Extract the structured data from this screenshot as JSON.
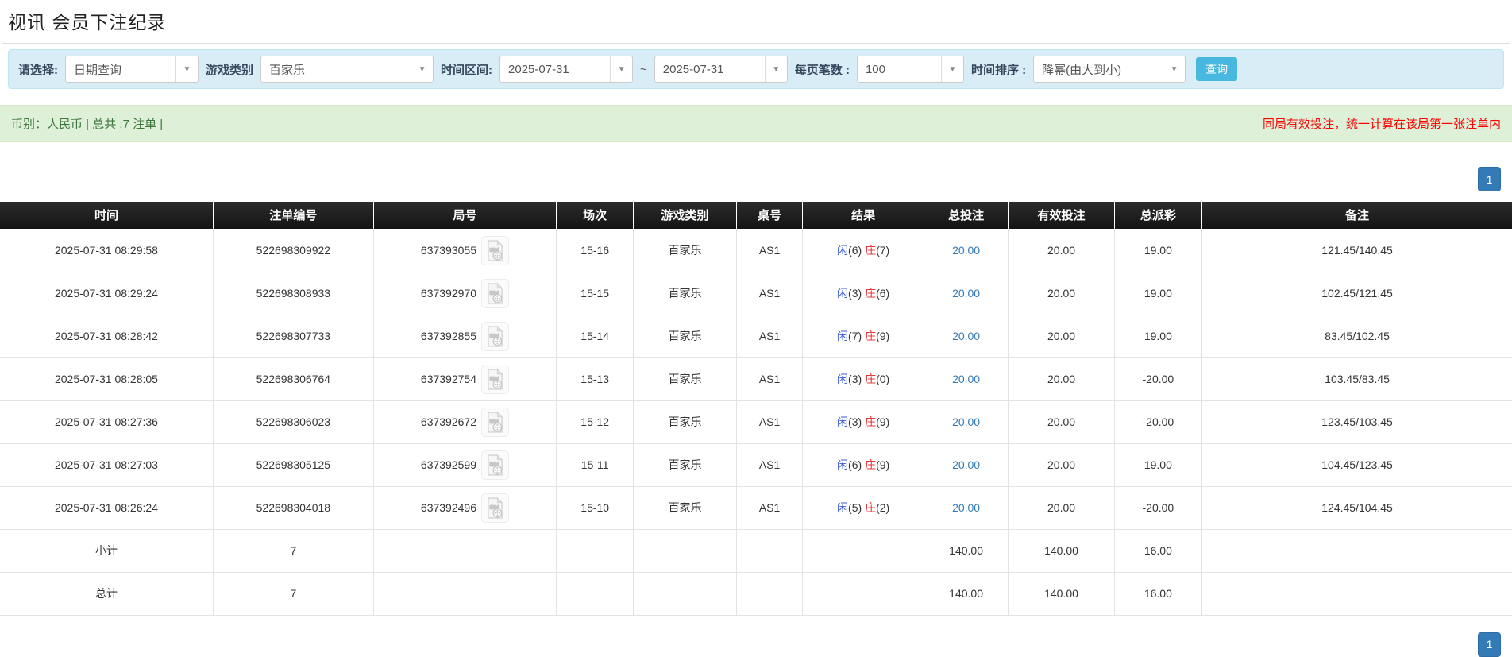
{
  "page": {
    "title": "视讯 会员下注纪录"
  },
  "colors": {
    "link_blue": "#337ab7",
    "player_blue": "#3a5bd9",
    "banker_red": "#e4393c",
    "negative_red": "#e4393c",
    "notice_red": "#ff0000",
    "search_btn": "#49b8e0",
    "pager_blue": "#337ab7",
    "header_bg": "#1f1f1f",
    "summary_bg": "#9d9d9d",
    "filter_bar_bg": "#d9edf7",
    "info_bar_bg": "#dff0d8"
  },
  "icons": {
    "dropdown_caret": "▼",
    "video_icon": "video-file"
  },
  "filters": {
    "select_label": "请选择:",
    "select_value": "日期查询",
    "game_type_label": "游戏类别",
    "game_type_value": "百家乐",
    "date_range_label": "时间区间:",
    "date_from": "2025-07-31",
    "date_separator": "~",
    "date_to": "2025-07-31",
    "page_size_label": "每页笔数 :",
    "page_size_value": "100",
    "sort_label": "时间排序 :",
    "sort_value": "降幂(由大到小)",
    "search_button": "查询"
  },
  "info_bar": {
    "left_text": "币别：人民币 | 总共 :7 注单 |",
    "right_text": "同局有效投注，统一计算在该局第一张注单内"
  },
  "pagination": {
    "page": "1"
  },
  "table": {
    "headers": [
      "时间",
      "注单编号",
      "局号",
      "场次",
      "游戏类别",
      "桌号",
      "结果",
      "总投注",
      "有效投注",
      "总派彩",
      "备注"
    ],
    "rows": [
      {
        "time": "2025-07-31 08:29:58",
        "bet_id": "522698309922",
        "round_id": "637393055",
        "session": "15-16",
        "game": "百家乐",
        "table_no": "AS1",
        "result_player_label": "闲",
        "result_player_value": "(6)",
        "result_banker_label": "庄",
        "result_banker_value": "(7)",
        "total_bet": "20.00",
        "valid_bet": "20.00",
        "payout": "19.00",
        "remark": "121.45/140.45"
      },
      {
        "time": "2025-07-31 08:29:24",
        "bet_id": "522698308933",
        "round_id": "637392970",
        "session": "15-15",
        "game": "百家乐",
        "table_no": "AS1",
        "result_player_label": "闲",
        "result_player_value": "(3)",
        "result_banker_label": "庄",
        "result_banker_value": "(6)",
        "total_bet": "20.00",
        "valid_bet": "20.00",
        "payout": "19.00",
        "remark": "102.45/121.45"
      },
      {
        "time": "2025-07-31 08:28:42",
        "bet_id": "522698307733",
        "round_id": "637392855",
        "session": "15-14",
        "game": "百家乐",
        "table_no": "AS1",
        "result_player_label": "闲",
        "result_player_value": "(7)",
        "result_banker_label": "庄",
        "result_banker_value": "(9)",
        "total_bet": "20.00",
        "valid_bet": "20.00",
        "payout": "19.00",
        "remark": "83.45/102.45"
      },
      {
        "time": "2025-07-31 08:28:05",
        "bet_id": "522698306764",
        "round_id": "637392754",
        "session": "15-13",
        "game": "百家乐",
        "table_no": "AS1",
        "result_player_label": "闲",
        "result_player_value": "(3)",
        "result_banker_label": "庄",
        "result_banker_value": "(0)",
        "total_bet": "20.00",
        "valid_bet": "20.00",
        "payout": "-20.00",
        "remark": "103.45/83.45"
      },
      {
        "time": "2025-07-31 08:27:36",
        "bet_id": "522698306023",
        "round_id": "637392672",
        "session": "15-12",
        "game": "百家乐",
        "table_no": "AS1",
        "result_player_label": "闲",
        "result_player_value": "(3)",
        "result_banker_label": "庄",
        "result_banker_value": "(9)",
        "total_bet": "20.00",
        "valid_bet": "20.00",
        "payout": "-20.00",
        "remark": "123.45/103.45"
      },
      {
        "time": "2025-07-31 08:27:03",
        "bet_id": "522698305125",
        "round_id": "637392599",
        "session": "15-11",
        "game": "百家乐",
        "table_no": "AS1",
        "result_player_label": "闲",
        "result_player_value": "(6)",
        "result_banker_label": "庄",
        "result_banker_value": "(9)",
        "total_bet": "20.00",
        "valid_bet": "20.00",
        "payout": "19.00",
        "remark": "104.45/123.45"
      },
      {
        "time": "2025-07-31 08:26:24",
        "bet_id": "522698304018",
        "round_id": "637392496",
        "session": "15-10",
        "game": "百家乐",
        "table_no": "AS1",
        "result_player_label": "闲",
        "result_player_value": "(5)",
        "result_banker_label": "庄",
        "result_banker_value": "(2)",
        "total_bet": "20.00",
        "valid_bet": "20.00",
        "payout": "-20.00",
        "remark": "124.45/104.45"
      }
    ],
    "subtotal": {
      "label": "小计",
      "count": "7",
      "total_bet": "140.00",
      "valid_bet": "140.00",
      "payout": "16.00"
    },
    "total": {
      "label": "总计",
      "count": "7",
      "total_bet": "140.00",
      "valid_bet": "140.00",
      "payout": "16.00"
    }
  }
}
